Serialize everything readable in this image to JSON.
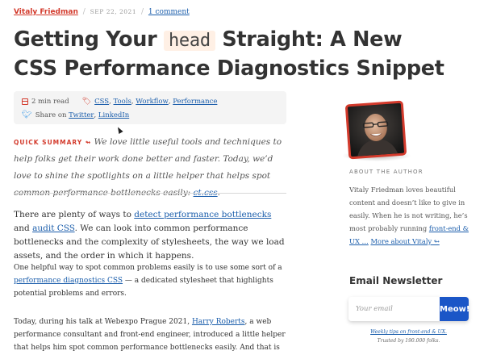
{
  "byline": {
    "author": "Vitaly Friedman",
    "separator": "/",
    "date": "Sep 22, 2021",
    "comments": "1 comment"
  },
  "article": {
    "title_part1": "Getting Your",
    "title_code": "head",
    "title_part2": "Straight: A New CSS Performance Diagnostics Snippet",
    "meta": {
      "read_time": "2 min read",
      "tags": [
        "CSS",
        "Tools",
        "Workflow",
        "Performance"
      ],
      "share_prefix": "Share on",
      "share_links": [
        "Twitter",
        "LinkedIn"
      ]
    },
    "summary": {
      "label": "Quick summary ↬",
      "text": "We love little useful tools and techniques to help folks get their work done better and faster. Today, we’d love to shine the spotlights on a little helper that helps spot common performance bottlenecks easily:",
      "link": "ct.css",
      "end": "."
    },
    "p1": {
      "t1": "There are plenty of ways to",
      "link1": "detect performance bottlenecks",
      "t2": "and",
      "link2": "audit CSS",
      "t3": ". We can look into common performance bottlenecks and the complexity of stylesheets, the way we load assets, and the order in which it happens."
    },
    "p2": {
      "t1": "One helpful way to spot common problems easily is to use some sort of a",
      "link1": "performance diagnostics CSS",
      "t2": "— a dedicated stylesheet that highlights potential problems and errors."
    },
    "p3": {
      "t1": "Today, during his talk at Webexpo Prague 2021,",
      "link1": "Harry Roberts",
      "t2": ", a web performance consultant and front-end engineer, introduced a little helper that helps him spot common performance bottlenecks easily. And that is mostly related to the order of"
    }
  },
  "sidebar": {
    "about_heading": "About The Author",
    "about": {
      "text": "Vitaly Friedman loves beautiful content and doesn’t like to give in easily. When he is not writing, he’s most probably running",
      "link1": "front-end & UX …",
      "link2": "More about Vitaly ↬"
    },
    "newsletter": {
      "heading": "Email Newsletter",
      "placeholder": "Your email",
      "button": "Meow!",
      "sub_link": "Weekly tips on front-end & UX.",
      "sub_text": "Trusted by 190.000 folks."
    }
  },
  "colors": {
    "accent": "#d33a2c",
    "link": "#1a5dab",
    "button": "#1b56c7"
  }
}
